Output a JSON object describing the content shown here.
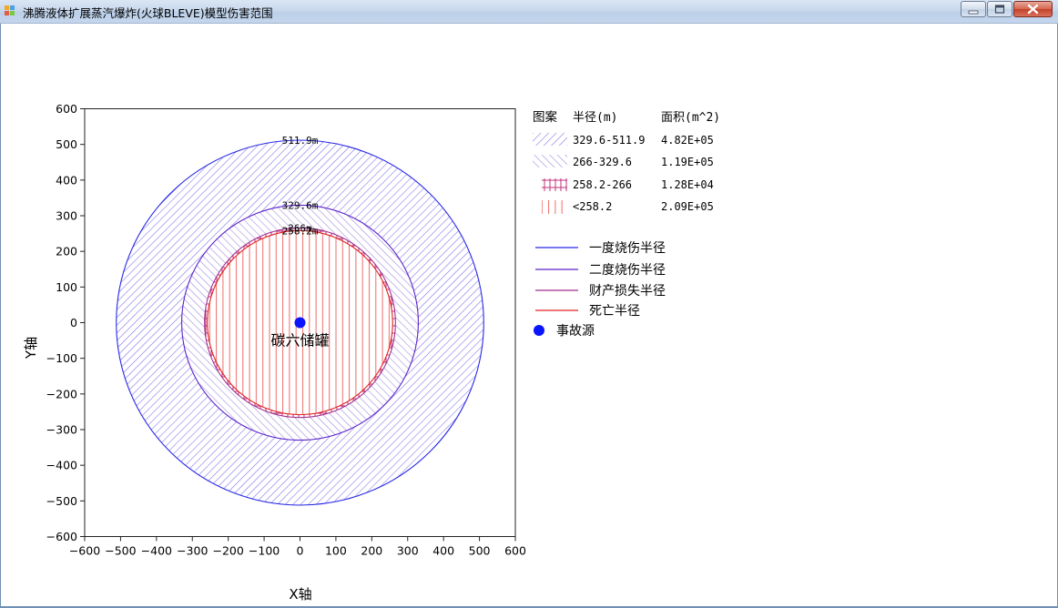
{
  "window": {
    "title": "沸腾液体扩展蒸汽爆炸(火球BLEVE)模型伤害范围",
    "minimize_label": "minimize",
    "maximize_label": "maximize",
    "close_label": "close",
    "icon": "app-window-icon"
  },
  "chart_data": {
    "type": "scatter",
    "xlabel": "X轴",
    "ylabel": "Y轴",
    "xlim": [
      -600,
      600
    ],
    "ylim": [
      -600,
      600
    ],
    "x_ticks": [
      -600,
      -500,
      -400,
      -300,
      -200,
      -100,
      0,
      100,
      200,
      300,
      400,
      500,
      600
    ],
    "y_ticks": [
      600,
      500,
      400,
      300,
      200,
      100,
      0,
      -100,
      -200,
      -300,
      -400,
      -500,
      -600
    ],
    "grid": false,
    "legend_position": "right",
    "circles": [
      {
        "name": "一度烧伤半径",
        "radius": 511.9,
        "label": "511.9m",
        "color": "#2828e6"
      },
      {
        "name": "二度烧伤半径",
        "radius": 329.6,
        "label": "329.6m",
        "color": "#5a22c8"
      },
      {
        "name": "财产损失半径",
        "radius": 266,
        "label": "266m",
        "color": "#a0308c"
      },
      {
        "name": "死亡半径",
        "radius": 258.2,
        "label": "258.2m",
        "color": "#e02020"
      }
    ],
    "source": {
      "name": "事故源",
      "x": 0,
      "y": 0,
      "label": "碳六储罐",
      "color": "#0a14ff"
    },
    "legend": {
      "header_pattern": "图案",
      "header_radius": "半径(m)",
      "header_area": "面积(m^2)",
      "zones": [
        {
          "pattern": "hatch-forward-blue",
          "range": "329.6-511.9",
          "area": "4.82E+05"
        },
        {
          "pattern": "hatch-back-purple",
          "range": "266-329.6",
          "area": "1.19E+05"
        },
        {
          "pattern": "cross-magenta",
          "range": "258.2-266",
          "area": "1.28E+04"
        },
        {
          "pattern": "vertical-red",
          "range": "<258.2",
          "area": "2.09E+05"
        }
      ]
    }
  }
}
